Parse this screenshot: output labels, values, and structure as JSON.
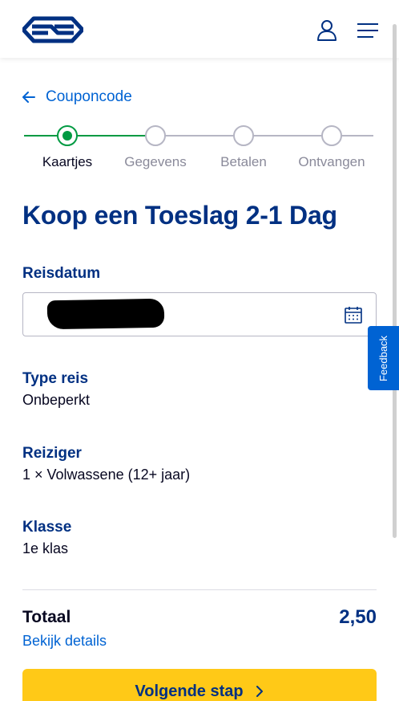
{
  "header": {
    "logo_icon": "ns-logo",
    "user_icon": "user-icon",
    "menu_icon": "hamburger-menu-icon"
  },
  "back_link": {
    "label": "Couponcode",
    "icon": "arrow-left-icon"
  },
  "stepper": {
    "steps": [
      {
        "label": "Kaartjes",
        "active": true
      },
      {
        "label": "Gegevens",
        "active": false
      },
      {
        "label": "Betalen",
        "active": false
      },
      {
        "label": "Ontvangen",
        "active": false
      }
    ]
  },
  "page_title": "Koop een Toeslag 2-1 Dag",
  "reisdatum": {
    "label": "Reisdatum",
    "icon": "calendar-icon"
  },
  "type_reis": {
    "label": "Type reis",
    "value": "Onbeperkt"
  },
  "reiziger": {
    "label": "Reiziger",
    "value": "1 × Volwassene (12+ jaar)"
  },
  "klasse": {
    "label": "Klasse",
    "value": "1e klas"
  },
  "feedback": {
    "label": "Feedback"
  },
  "totaal": {
    "label": "Totaal",
    "amount": "2,50",
    "details_link": "Bekijk details"
  },
  "cta": {
    "label": "Volgende stap",
    "icon": "chevron-right-icon"
  },
  "colors": {
    "brand_blue": "#003082",
    "link_blue": "#0063d3",
    "accent_yellow": "#ffc917",
    "step_green": "#009a42"
  }
}
